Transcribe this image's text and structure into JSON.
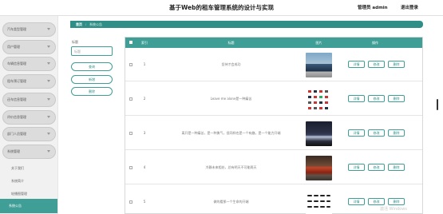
{
  "header": {
    "title": "基于Web的租车管理系统的设计与实现",
    "admin": "管理员 admin",
    "logout": "退出登录"
  },
  "sidebar": {
    "menus": [
      {
        "label": "汽车类型管理"
      },
      {
        "label": "用户管理"
      },
      {
        "label": "车辆信息管理"
      },
      {
        "label": "租车预订管理"
      },
      {
        "label": "还车信息管理"
      },
      {
        "label": "评价信息管理"
      },
      {
        "label": "部门人员管理"
      },
      {
        "label": "系统管理"
      }
    ],
    "subitems": [
      {
        "label": "关于我们"
      },
      {
        "label": "系统简介"
      },
      {
        "label": "轮播图管理"
      },
      {
        "label": "系统公告"
      }
    ]
  },
  "breadcrumb": {
    "home": "首页",
    "separator": "/",
    "current": "系统公告"
  },
  "search": {
    "label": "标题",
    "placeholder": "标题",
    "query_button": "查询",
    "add_button": "新增",
    "delete_button": "删除"
  },
  "table": {
    "headers": {
      "index": "索引",
      "title": "标题",
      "image": "图片",
      "actions": "操作"
    },
    "action_labels": {
      "detail": "详情",
      "edit": "修改",
      "delete": "删除"
    },
    "rows": [
      {
        "index": "1",
        "title": "坚持才会成功"
      },
      {
        "index": "2",
        "title": "Leave me alone是一种痛苦"
      },
      {
        "index": "3",
        "title": "离开是一种痛苦，是一种勇气，但同样也是一个有趣，是一个能力开端"
      },
      {
        "index": "4",
        "title": "冷静未来相处，总有明天不可能两天"
      },
      {
        "index": "5",
        "title": "做的看那一个生命的开端"
      }
    ]
  },
  "watermark": "激活 Windows",
  "colors": {
    "accent": "#3f9e96",
    "breadcrumb": "#2f8f88",
    "sidebar_bg": "#f1f1f1",
    "menu_bg": "#dcdcdc"
  }
}
